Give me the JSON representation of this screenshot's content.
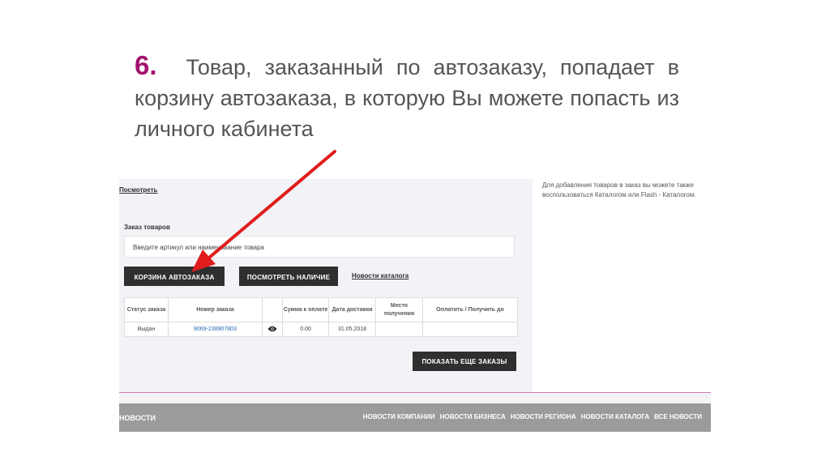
{
  "slide": {
    "number": "6.",
    "text": "Товар, заказанный по автозаказу, попадает в корзину автозаказа, в которую Вы можете попасть из личного кабинета"
  },
  "page": {
    "view_link": "Посмотреть",
    "hint": "Для добавления товаров в заказ вы можете также воспользоваться Каталогом или Flash - Каталогом.",
    "order_section_label": "Заказ товаров",
    "search_placeholder": "Введите артикул или наименование товара",
    "autoorder_button": "КОРЗИНА АВТОЗАКАЗА",
    "check_stock_button": "ПОСМОТРЕТЬ НАЛИЧИЕ",
    "catalog_news_link": "Новости каталога",
    "show_more_button": "ПОКАЗАТЬ ЕЩЕ ЗАКАЗЫ"
  },
  "orders_table": {
    "headers": [
      "Статус заказа",
      "Номер заказа",
      "",
      "Сумма к оплате",
      "Дата доставки",
      "Место получения",
      "Оплатить / Получить до"
    ],
    "rows": [
      {
        "status": "Выдан",
        "number": "9069-238907803",
        "sum": "0.00",
        "date": "31.05.2018",
        "place": "",
        "due": ""
      }
    ]
  },
  "footer": {
    "title": "НОВОСТИ",
    "links": [
      "НОВОСТИ КОМПАНИИ",
      "НОВОСТИ БИЗНЕСА",
      "НОВОСТИ РЕГИОНА",
      "НОВОСТИ КАТАЛОГА",
      "ВСЕ НОВОСТИ"
    ]
  },
  "colors": {
    "accent_number": "#a3136e",
    "arrow": "#e01c1c",
    "button_dark": "#2f2f2f",
    "link_blue": "#2468b4"
  },
  "icons": {
    "view_order": "eye-icon",
    "pointer": "red-arrow"
  }
}
